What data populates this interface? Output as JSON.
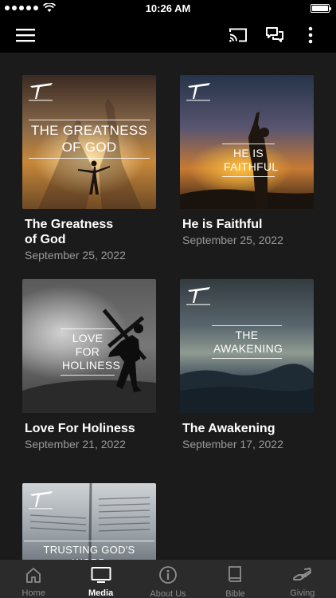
{
  "status_bar": {
    "time": "10:26 AM",
    "battery_level": 1.0
  },
  "nav": {
    "menu_icon": "hamburger-menu-icon",
    "cast_icon": "cast-icon",
    "chat_icon": "chat-bubbles-icon",
    "more_icon": "more-vertical-icon"
  },
  "media": [
    {
      "thumb_text": "THE GREATNESS\nOF GOD",
      "title": "The Greatness\nof God",
      "date": "September 25, 2022"
    },
    {
      "thumb_text": "HE IS\nFAITHFUL",
      "title": "He is Faithful",
      "date": "September 25, 2022"
    },
    {
      "thumb_text": "LOVE FOR\nHOLINESS",
      "title": "Love For Holiness",
      "date": "September 21, 2022"
    },
    {
      "thumb_text": "THE\nAWAKENING",
      "title": "The Awakening",
      "date": "September 17, 2022"
    },
    {
      "thumb_text": "TRUSTING GOD'S WORD",
      "title": "",
      "date": ""
    }
  ],
  "tabs": [
    {
      "label": "Home",
      "icon": "home-icon",
      "active": false
    },
    {
      "label": "Media",
      "icon": "tv-icon",
      "active": true
    },
    {
      "label": "About Us",
      "icon": "info-icon",
      "active": false
    },
    {
      "label": "Bible",
      "icon": "book-icon",
      "active": false
    },
    {
      "label": "Giving",
      "icon": "giving-hand-icon",
      "active": false
    }
  ],
  "colors": {
    "background": "#1b1b1b",
    "nav_background": "#000000",
    "tab_bar": "#2b2b2b",
    "date_text": "#9a9a9a"
  }
}
